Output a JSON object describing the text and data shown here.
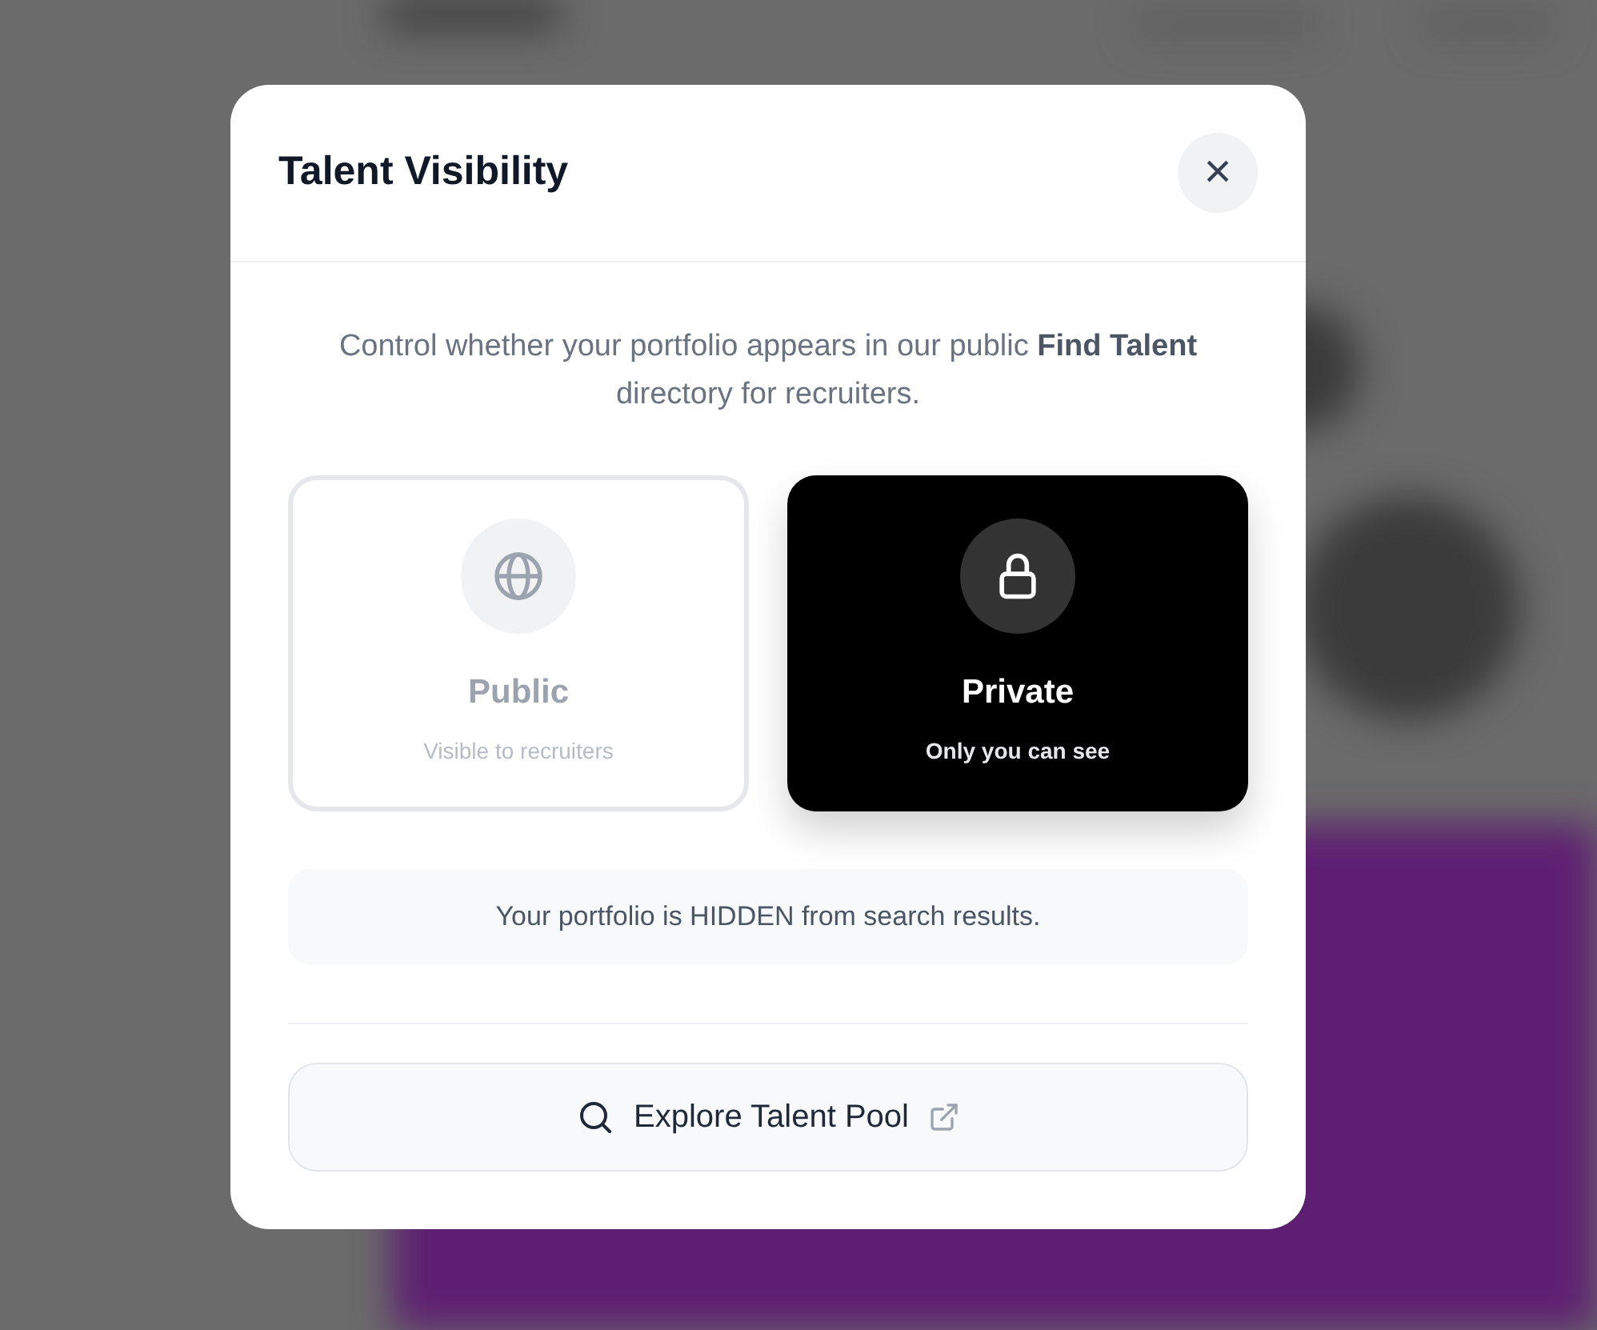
{
  "dialog": {
    "title": "Talent Visibility",
    "close_label": "×",
    "description": "Control whether your portfolio appears in our public **Find Talent** directory for recruiters.",
    "options": [
      {
        "kind": "globe",
        "label": "Public",
        "caption": "Visible to recruiters",
        "selected": false
      },
      {
        "kind": "lock",
        "label": "Private",
        "caption": "Only you can see",
        "selected": true
      }
    ],
    "status": "Your portfolio is HIDDEN from search results.",
    "button": {
      "label": "Explore Talent Pool"
    }
  }
}
